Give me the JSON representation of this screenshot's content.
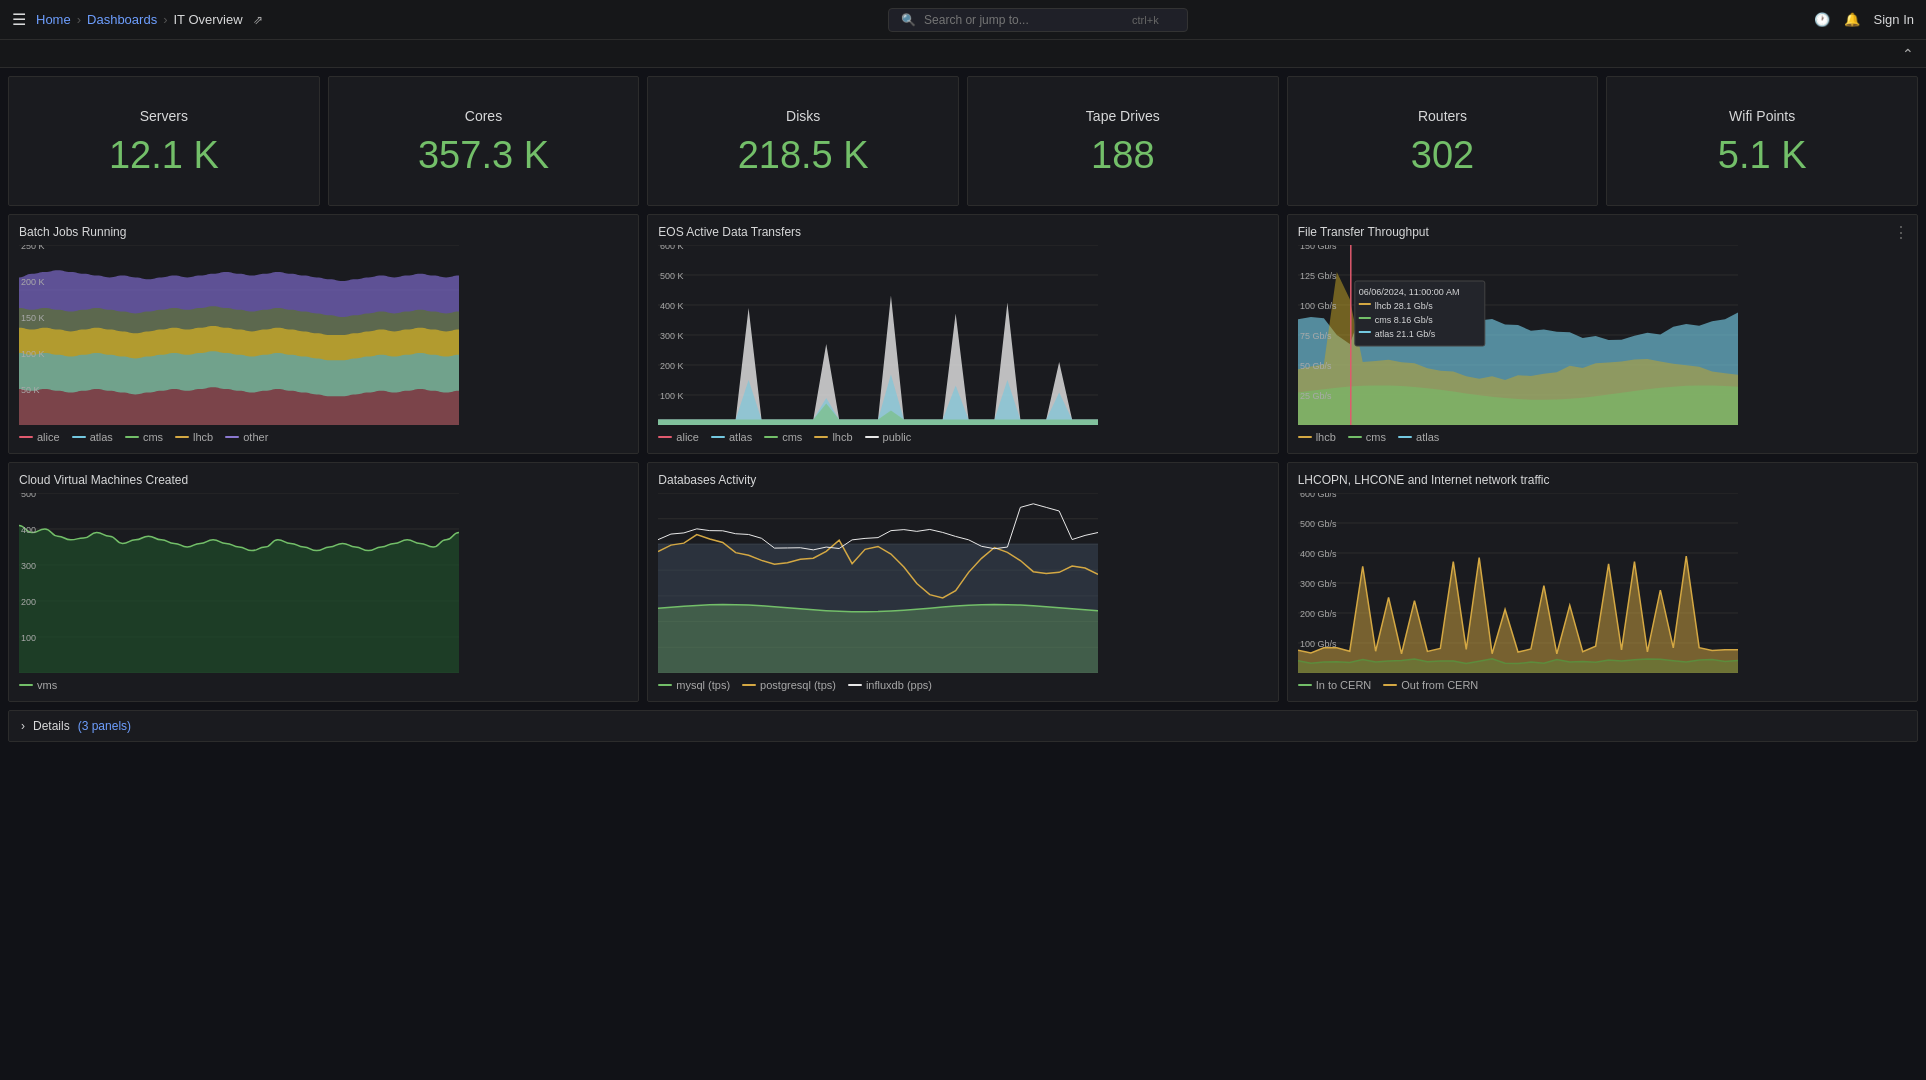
{
  "topbar": {
    "home": "Home",
    "dashboards": "Dashboards",
    "current_page": "IT Overview",
    "search_placeholder": "Search or jump to...",
    "shortcut": "ctrl+k",
    "sign_in": "Sign In"
  },
  "stats": [
    {
      "label": "Servers",
      "value": "12.1 K"
    },
    {
      "label": "Cores",
      "value": "357.3 K"
    },
    {
      "label": "Disks",
      "value": "218.5 K"
    },
    {
      "label": "Tape Drives",
      "value": "188"
    },
    {
      "label": "Routers",
      "value": "302"
    },
    {
      "label": "Wifi Points",
      "value": "5.1 K"
    }
  ],
  "panels_row1": [
    {
      "title": "Batch Jobs Running",
      "id": "batch-jobs",
      "legend": [
        {
          "label": "alice",
          "color": "#e05a6e"
        },
        {
          "label": "atlas",
          "color": "#73c8e0"
        },
        {
          "label": "cms",
          "color": "#73bf69"
        },
        {
          "label": "lhcb",
          "color": "#d4a843"
        },
        {
          "label": "other",
          "color": "#8b78d0"
        }
      ]
    },
    {
      "title": "EOS Active Data Transfers",
      "id": "eos-transfers",
      "legend": [
        {
          "label": "alice",
          "color": "#e05a6e"
        },
        {
          "label": "atlas",
          "color": "#73c8e0"
        },
        {
          "label": "cms",
          "color": "#73bf69"
        },
        {
          "label": "lhcb",
          "color": "#d4a843"
        },
        {
          "label": "public",
          "color": "#e8e8e8"
        }
      ]
    },
    {
      "title": "File Transfer Throughput",
      "id": "file-transfer",
      "has_menu": true,
      "tooltip": {
        "time": "06/06/2024, 11:00:00 AM",
        "values": [
          {
            "label": "lhcb",
            "value": "28.1 Gb/s",
            "color": "#d4a843"
          },
          {
            "label": "cms",
            "value": "8.16 Gb/s",
            "color": "#73bf69"
          },
          {
            "label": "atlas",
            "value": "21.1 Gb/s",
            "color": "#73c8e0"
          }
        ]
      },
      "legend": [
        {
          "label": "lhcb",
          "color": "#d4a843"
        },
        {
          "label": "cms",
          "color": "#73bf69"
        },
        {
          "label": "atlas",
          "color": "#73c8e0"
        }
      ]
    }
  ],
  "panels_row2": [
    {
      "title": "Cloud Virtual Machines Created",
      "id": "cloud-vms",
      "legend": [
        {
          "label": "vms",
          "color": "#73bf69"
        }
      ]
    },
    {
      "title": "Databases Activity",
      "id": "db-activity",
      "legend": [
        {
          "label": "mysql (tps)",
          "color": "#73bf69"
        },
        {
          "label": "postgresql (tps)",
          "color": "#d4a843"
        },
        {
          "label": "influxdb (pps)",
          "color": "#e8e8e8"
        }
      ]
    },
    {
      "title": "LHCOPN, LHCONE and Internet network traffic",
      "id": "network-traffic",
      "legend": [
        {
          "label": "In to CERN",
          "color": "#73bf69"
        },
        {
          "label": "Out from CERN",
          "color": "#d4a843"
        }
      ]
    }
  ],
  "details": {
    "label": "Details",
    "sub": "(3 panels)"
  }
}
